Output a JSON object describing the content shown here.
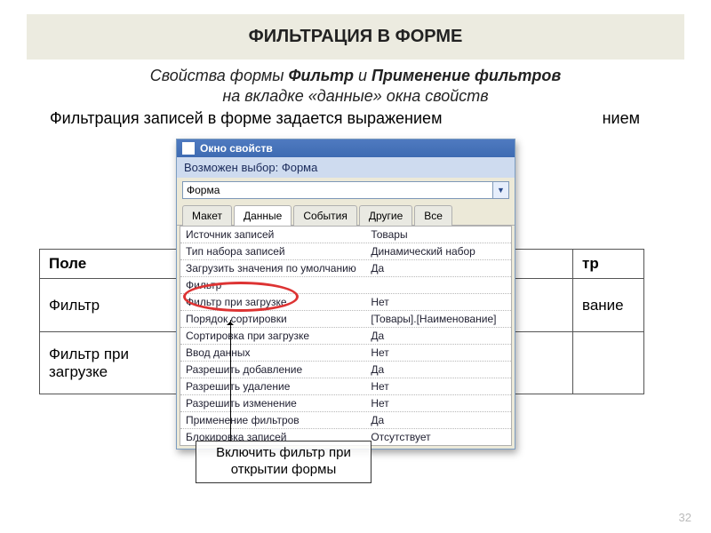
{
  "title": "ФИЛЬТРАЦИЯ В ФОРМЕ",
  "subtitle_pre": "Свойства формы ",
  "subtitle_b1": "Фильтр",
  "subtitle_mid": " и ",
  "subtitle_b2": "Применение фильтров",
  "subtitle_line2": "на вкладке «данные» окна свойств",
  "filter_line": "Фильтрация записей в форме задается выражением",
  "filter_right": "нием",
  "bgtable": {
    "h1": "Поле",
    "h2": "тр",
    "r1c1": "Фильтр",
    "r1c2": "вание",
    "r2c1": "Фильтр при загрузке",
    "r2c2": ""
  },
  "win_title": "Окно свойств",
  "sel_label": "Возможен выбор:  Форма",
  "combo_value": "Форма",
  "tabs": [
    "Макет",
    "Данные",
    "События",
    "Другие",
    "Все"
  ],
  "active_tab": 1,
  "rows": [
    [
      "Источник записей",
      "Товары"
    ],
    [
      "Тип набора записей",
      "Динамический набор"
    ],
    [
      "Загрузить значения по умолчанию",
      "Да"
    ],
    [
      "Фильтр",
      ""
    ],
    [
      "Фильтр при загрузке",
      "Нет"
    ],
    [
      "Порядок сортировки",
      "[Товары].[Наименование]"
    ],
    [
      "Сортировка при загрузке",
      "Да"
    ],
    [
      "Ввод данных",
      "Нет"
    ],
    [
      "Разрешить добавление",
      "Да"
    ],
    [
      "Разрешить удаление",
      "Нет"
    ],
    [
      "Разрешить изменение",
      "Нет"
    ],
    [
      "Применение фильтров",
      "Да"
    ],
    [
      "Блокировка записей",
      "Отсутствует"
    ]
  ],
  "callout": "Включить фильтр при открытии формы",
  "pagenum": "32"
}
